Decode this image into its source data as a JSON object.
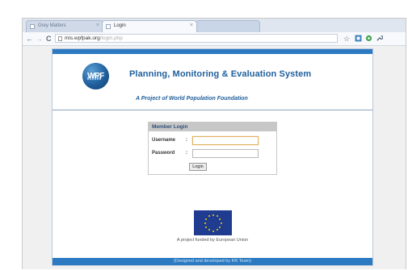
{
  "browser": {
    "tabs": [
      {
        "label": "Grey Matters"
      },
      {
        "label": "Login"
      },
      {
        "label": ""
      }
    ],
    "address": {
      "host": "mis.wpfpak.org",
      "path": "/login.php"
    },
    "nav": {
      "back": "←",
      "forward": "→",
      "reload": "C"
    }
  },
  "site": {
    "logo_text": "WPF",
    "title": "Planning, Monitoring & Evaluation System",
    "subtitle": "A Project of World Population Foundation"
  },
  "login": {
    "header": "Member Login",
    "username_label": "Username",
    "password_label": "Password",
    "separator": ":",
    "username_value": "",
    "password_value": "",
    "button_label": "Login"
  },
  "footer": {
    "funded_text": "A project funded by European Union",
    "credit_text": "(Designed and developed by KR Team)"
  },
  "colors": {
    "brand_blue": "#2c7bc2",
    "title_blue": "#1f5f9c",
    "eu_blue": "#1f3c91",
    "eu_star": "#f2d100"
  }
}
